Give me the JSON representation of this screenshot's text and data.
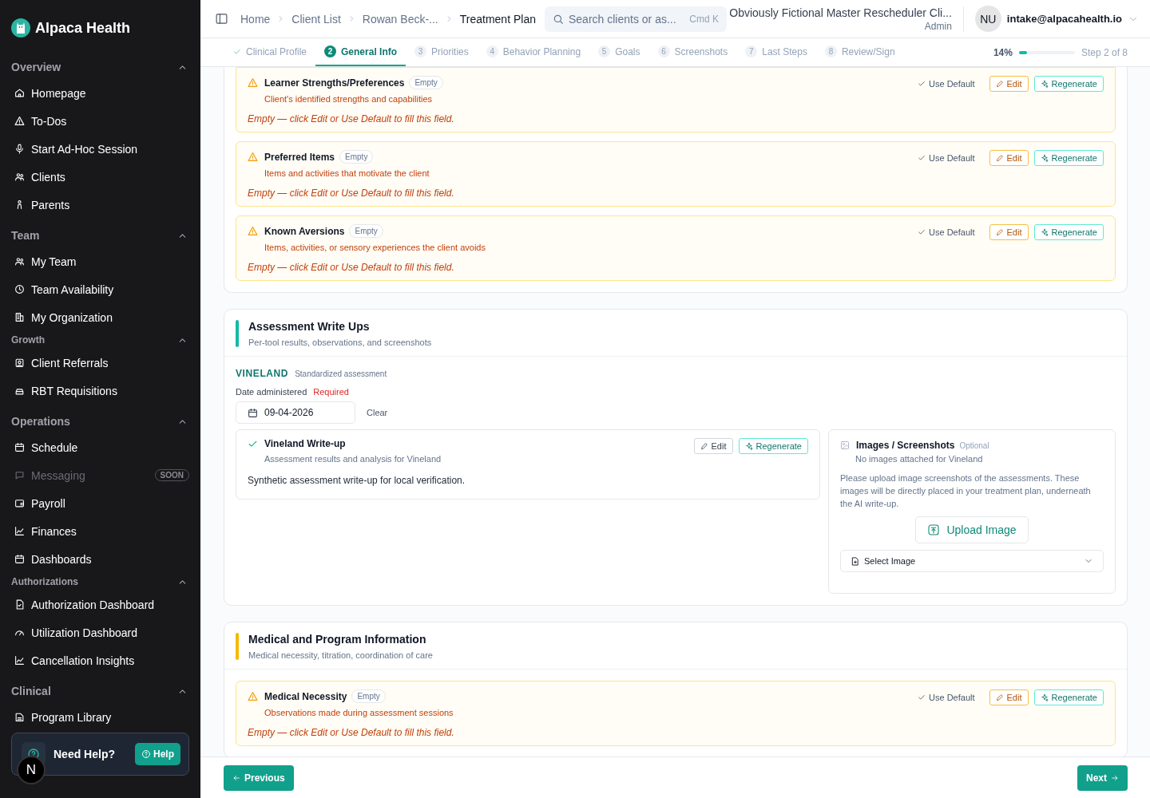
{
  "sidebar": {
    "brand": "Alpaca Health",
    "groups": [
      {
        "title": "Overview",
        "kind": "major",
        "expanded": true,
        "items": [
          {
            "label": "Homepage",
            "disabled": false
          },
          {
            "label": "To-Dos",
            "disabled": false
          },
          {
            "label": "Start Ad-Hoc Session",
            "disabled": false
          },
          {
            "label": "Clients",
            "disabled": false
          },
          {
            "label": "Parents",
            "disabled": false
          }
        ]
      },
      {
        "title": "Team",
        "kind": "major",
        "expanded": true,
        "items": [
          {
            "label": "My Team",
            "disabled": false
          },
          {
            "label": "Team Availability",
            "disabled": false
          },
          {
            "label": "My Organization",
            "disabled": false
          }
        ]
      },
      {
        "title": "Growth",
        "kind": "minor",
        "expanded": true,
        "items": [
          {
            "label": "Client Referrals",
            "disabled": false
          },
          {
            "label": "RBT Requisitions",
            "disabled": false
          }
        ]
      },
      {
        "title": "Operations",
        "kind": "major",
        "expanded": true,
        "items": [
          {
            "label": "Schedule",
            "disabled": false
          },
          {
            "label": "Messaging",
            "disabled": true,
            "badge": "SOON"
          },
          {
            "label": "Payroll",
            "disabled": false
          },
          {
            "label": "Finances",
            "disabled": false
          },
          {
            "label": "Dashboards",
            "disabled": false
          }
        ]
      },
      {
        "title": "Authorizations",
        "kind": "minor",
        "expanded": true,
        "items": [
          {
            "label": "Authorization Dashboard",
            "disabled": false
          },
          {
            "label": "Utilization Dashboard",
            "disabled": false
          },
          {
            "label": "Cancellation Insights",
            "disabled": false
          }
        ]
      },
      {
        "title": "Clinical",
        "kind": "major",
        "expanded": true,
        "items": [
          {
            "label": "Program Library",
            "disabled": false
          }
        ]
      }
    ],
    "help": {
      "title": "Need Help?",
      "button": "Help"
    },
    "dev_badge": "N"
  },
  "header": {
    "breadcrumbs": [
      "Home",
      "Client List",
      "Rowan Beck-...",
      "Treatment Plan"
    ],
    "search": {
      "placeholder": "Search clients or as...",
      "shortcut": "Cmd K"
    },
    "org": "Obviously Fictional Master Rescheduler Cli...",
    "role": "Admin",
    "user": {
      "initials": "NU",
      "email": "intake@alpacahealth.io"
    }
  },
  "steps": [
    {
      "label": "Clinical Profile",
      "done": true,
      "selected": false
    },
    {
      "number": "2",
      "label": "General Info",
      "done": false,
      "selected": true
    },
    {
      "number": "3",
      "label": "Priorities",
      "done": false,
      "selected": false
    },
    {
      "number": "4",
      "label": "Behavior Planning",
      "done": false,
      "selected": false
    },
    {
      "number": "5",
      "label": "Goals",
      "done": false,
      "selected": false
    },
    {
      "number": "6",
      "label": "Screenshots",
      "done": false,
      "selected": false
    },
    {
      "number": "7",
      "label": "Last Steps",
      "done": false,
      "selected": false
    },
    {
      "number": "8",
      "label": "Review/Sign",
      "done": false,
      "selected": false
    }
  ],
  "progress": {
    "percent": "14%",
    "level": 0.14,
    "step_text": "Step 2 of 8"
  },
  "sections": [
    {
      "kind": "fields",
      "fields": [
        {
          "title": "Learner Strengths/Preferences",
          "filled": false,
          "badge": "Empty",
          "description": "Client's identified strengths and capabilities",
          "empty_text": "Empty — click Edit or Use Default to fill this field.",
          "actions": [
            {
              "kind": "default",
              "label": "Use Default"
            },
            {
              "kind": "edit",
              "label": "Edit"
            },
            {
              "kind": "regenerate",
              "label": "Regenerate"
            }
          ]
        },
        {
          "title": "Preferred Items",
          "filled": false,
          "badge": "Empty",
          "description": "Items and activities that motivate the client",
          "empty_text": "Empty — click Edit or Use Default to fill this field.",
          "actions": [
            {
              "kind": "default",
              "label": "Use Default"
            },
            {
              "kind": "edit",
              "label": "Edit"
            },
            {
              "kind": "regenerate",
              "label": "Regenerate"
            }
          ]
        },
        {
          "title": "Known Aversions",
          "filled": false,
          "badge": "Empty",
          "description": "Items, activities, or sensory experiences the client avoids",
          "empty_text": "Empty — click Edit or Use Default to fill this field.",
          "actions": [
            {
              "kind": "default",
              "label": "Use Default"
            },
            {
              "kind": "edit",
              "label": "Edit"
            },
            {
              "kind": "regenerate",
              "label": "Regenerate"
            }
          ]
        }
      ]
    },
    {
      "kind": "assessment",
      "title": "Assessment Write Ups",
      "subtitle": "Per-tool results, observations, and screenshots",
      "color": "#14b8a6",
      "tool": {
        "name": "VINELAND",
        "caption": "Standardized assessment",
        "date_label": "Date administered",
        "required": "Required",
        "date_value": "09-04-2026",
        "clear": "Clear",
        "writeup": {
          "title": "Vineland Write-up",
          "filled": true,
          "description": "Assessment results and analysis for Vineland",
          "body": "Synthetic assessment write-up for local verification.",
          "actions": [
            {
              "kind": "edit",
              "label": "Edit"
            },
            {
              "kind": "regenerate",
              "label": "Regenerate"
            }
          ]
        },
        "images": {
          "title": "Images / Screenshots",
          "tag": "Optional",
          "status": "No images attached for Vineland",
          "note": "Please upload image screenshots of the assessments. These images will be directly placed in your treatment plan, underneath the AI write-up.",
          "upload": "Upload Image",
          "select": "Select Image"
        }
      }
    },
    {
      "kind": "fields",
      "title": "Medical and Program Information",
      "subtitle": "Medical necessity, titration, coordination of care",
      "color": "#f5b800",
      "fields": [
        {
          "title": "Medical Necessity",
          "filled": false,
          "badge": "Empty",
          "description": "Observations made during assessment sessions",
          "empty_text": "Empty — click Edit or Use Default to fill this field.",
          "actions": [
            {
              "kind": "default",
              "label": "Use Default"
            },
            {
              "kind": "edit",
              "label": "Edit"
            },
            {
              "kind": "regenerate",
              "label": "Regenerate"
            }
          ]
        }
      ]
    }
  ],
  "footer": {
    "previous": "Previous",
    "next": "Next"
  }
}
